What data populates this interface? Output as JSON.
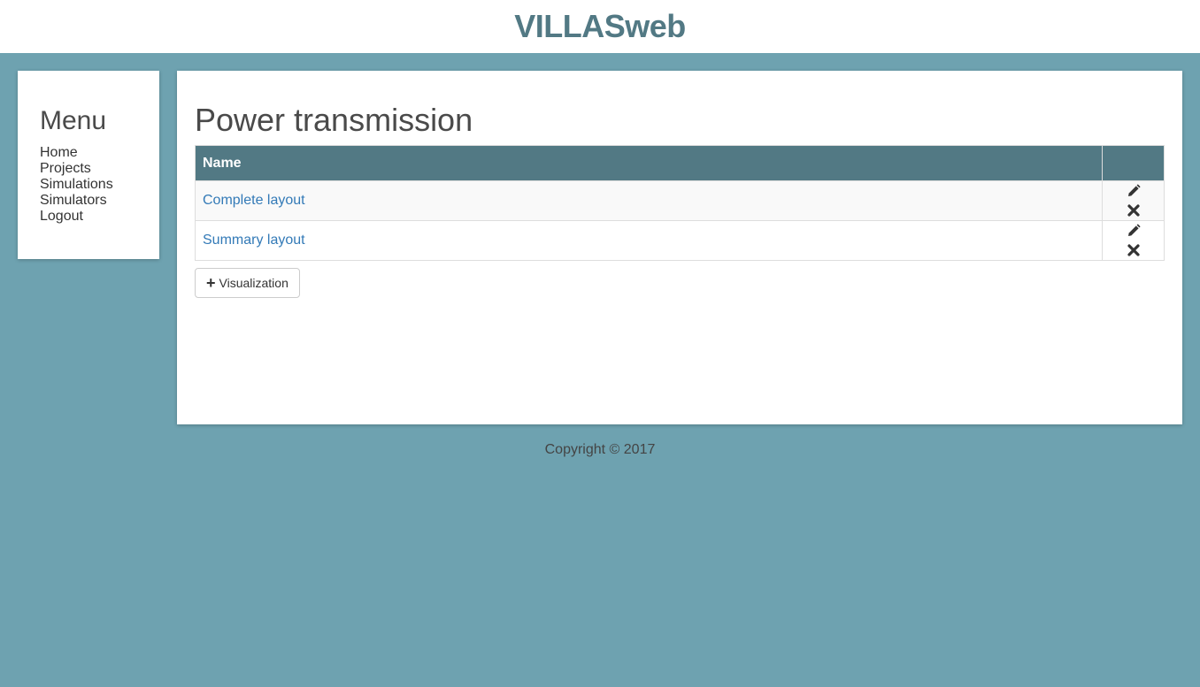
{
  "header": {
    "title": "VILLASweb"
  },
  "menu": {
    "title": "Menu",
    "items": [
      {
        "label": "Home"
      },
      {
        "label": "Projects"
      },
      {
        "label": "Simulations"
      },
      {
        "label": "Simulators"
      },
      {
        "label": "Logout"
      }
    ]
  },
  "page": {
    "title": "Power transmission",
    "table": {
      "columns": {
        "name": "Name",
        "actions": ""
      },
      "rows": [
        {
          "name": "Complete layout"
        },
        {
          "name": "Summary layout"
        }
      ]
    },
    "add_button": {
      "icon": "plus-icon",
      "label": "Visualization"
    }
  },
  "footer": {
    "text": "Copyright © 2017"
  },
  "colors": {
    "brand": "#527984",
    "background": "#6ea2b0",
    "link": "#337ab7"
  }
}
